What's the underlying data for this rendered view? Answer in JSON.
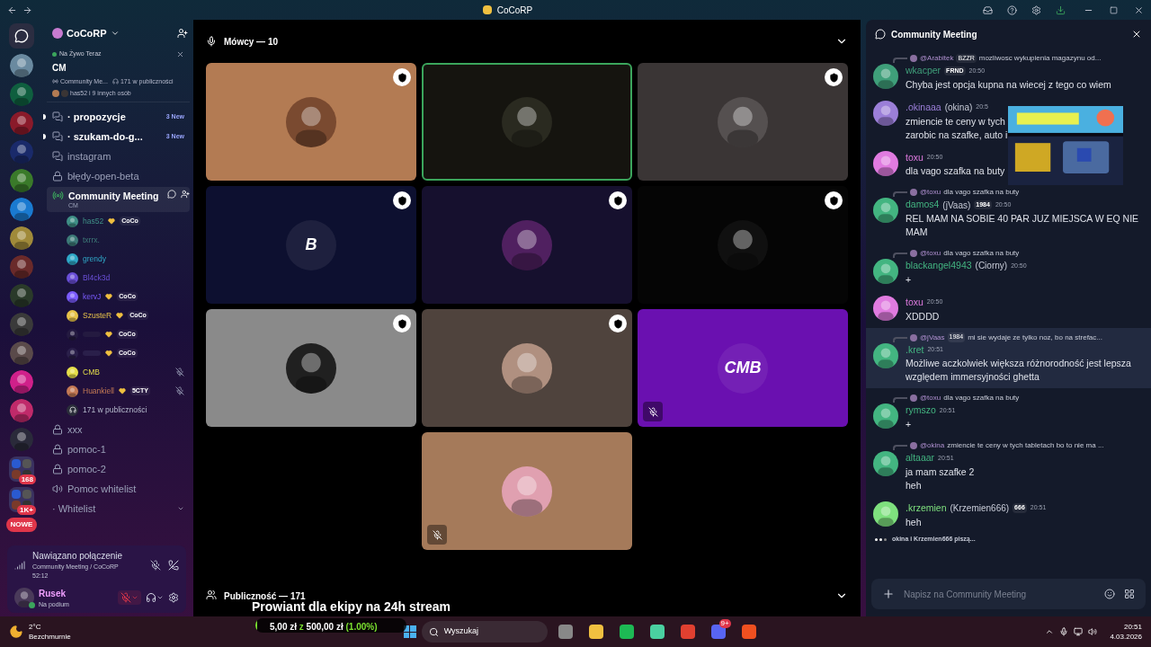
{
  "titlebar": {
    "title": "CoCoRP"
  },
  "servers": [
    {
      "kind": "home"
    },
    {
      "kind": "app"
    },
    {
      "kind": "app"
    },
    {
      "kind": "app"
    },
    {
      "kind": "app"
    },
    {
      "kind": "app"
    },
    {
      "kind": "app"
    },
    {
      "kind": "app"
    },
    {
      "kind": "app"
    },
    {
      "kind": "app"
    },
    {
      "kind": "app"
    },
    {
      "kind": "app"
    },
    {
      "kind": "app"
    },
    {
      "kind": "app"
    },
    {
      "kind": "app"
    },
    {
      "kind": "folder",
      "badge": "168"
    },
    {
      "kind": "folder",
      "badge": "1K+"
    },
    {
      "kind": "pill",
      "label": "NOWE"
    }
  ],
  "sidebar": {
    "server_name": "CoCoRP",
    "live": {
      "label": "Na Żywo Teraz",
      "title": "CM",
      "channel": "Community Me...",
      "audience": "171 w publiczności",
      "participants": "has52 i 9 innych osób"
    },
    "channels": [
      {
        "kind": "forum",
        "name": "· propozycje",
        "badge": "3 New",
        "unread": true,
        "selected": false
      },
      {
        "kind": "forum",
        "name": "· szukam-do-g...",
        "badge": "3 New",
        "unread": true,
        "selected": false
      },
      {
        "kind": "forum",
        "name": "instagram",
        "unread": false,
        "selected": false
      },
      {
        "kind": "locked",
        "name": "błędy-open-beta",
        "unread": false,
        "selected": false
      },
      {
        "kind": "stage",
        "name": "Community Meeting",
        "subtitle": "CM",
        "unread": true,
        "selected": true,
        "audience": "171 w publiczności",
        "members": [
          {
            "name": "has52",
            "color": "#3f8f86",
            "tag": "CoCo",
            "muted": false
          },
          {
            "name": "txrrx.",
            "color": "#3d7a78",
            "muted": false
          },
          {
            "name": "grendy",
            "color": "#2fa8c8",
            "muted": false
          },
          {
            "name": "Bl4ck3d",
            "color": "#6a4fd8",
            "muted": false
          },
          {
            "name": "kervJ",
            "color": "#7b5cff",
            "tag": "CoCo",
            "muted": false
          },
          {
            "name": "SzusteR",
            "color": "#e8c34a",
            "tag": "CoCo",
            "muted": false
          },
          {
            "tag": "CoCo",
            "color": "#241a40",
            "muted": false
          },
          {
            "tag": "CoCo",
            "color": "#2a1f4a",
            "muted": false
          },
          {
            "name": "CMB",
            "color": "#e6df4a",
            "muted": true
          },
          {
            "name": "Huankiell",
            "color": "#c47a55",
            "tag": "5CTY",
            "muted": true
          }
        ]
      },
      {
        "kind": "locked",
        "name": "xxx",
        "unread": false,
        "selected": false
      },
      {
        "kind": "locked",
        "name": "pomoc-1",
        "unread": false,
        "selected": false
      },
      {
        "kind": "locked",
        "name": "pomoc-2",
        "unread": false,
        "selected": false
      },
      {
        "kind": "voice",
        "name": "Pomoc whitelist",
        "unread": false,
        "selected": false
      },
      {
        "kind": "category",
        "name": "· Whitelist",
        "unread": false,
        "selected": false
      }
    ],
    "connection": {
      "status": "Nawiązano połączenie",
      "channel": "Community Meeting / CoCoRP",
      "timer": "52:12"
    },
    "user": {
      "name": "Rusek",
      "status": "Na podium",
      "mic_muted": true
    }
  },
  "stage": {
    "speakers": "Mówcy — 10",
    "audience": "Publiczność — 171",
    "tiles": [
      {
        "color": "#b37b53",
        "speaking": false,
        "moderator": true,
        "muted": false
      },
      {
        "color": "#15140f",
        "speaking": true,
        "moderator": false,
        "muted": false
      },
      {
        "color": "#3a3535",
        "speaking": false,
        "moderator": true,
        "muted": false
      },
      {
        "color": "#0d1030",
        "speaking": false,
        "moderator": true,
        "muted": false,
        "logo": "B"
      },
      {
        "color": "#16102e",
        "speaking": false,
        "moderator": true,
        "muted": false
      },
      {
        "color": "#050505",
        "speaking": false,
        "moderator": true,
        "muted": false
      },
      {
        "color": "#8a8a8a",
        "speaking": false,
        "moderator": true,
        "muted": false
      },
      {
        "color": "#4f433d",
        "speaking": false,
        "moderator": true,
        "muted": false
      },
      {
        "color": "#6a10b0",
        "speaking": false,
        "moderator": false,
        "muted": true,
        "logo": "CMB"
      },
      {
        "color": "#a57a5a",
        "speaking": false,
        "moderator": false,
        "muted": true
      }
    ]
  },
  "overlay": {
    "caption": "Prowiant dla ekipy na 24h stream",
    "amount": "5,00 zł",
    "separator": "z",
    "goal": "500,00 zł",
    "percent": "(1.00%)",
    "level": 0.01
  },
  "chat": {
    "title": "Community Meeting",
    "messages": [
      {
        "reply": {
          "name": "@Arabitek",
          "tag": "BZZR",
          "text": "mozliwosc wykupienia magazynu od..."
        },
        "author": "wkacper",
        "color": "#3f9f7a",
        "tag": "FRND",
        "time": "20:50",
        "lines": [
          "Chyba jest opcja kupna na wiecej z tego co wiem"
        ],
        "highlighted": false
      },
      {
        "author": ".okinaaa",
        "nick": "(okina)",
        "color": "#9b7fd8",
        "time": "20:5",
        "lines": [
          "zmiencie te ceny w tych",
          "zarobic na szafke, auto i"
        ],
        "highlighted": false
      },
      {
        "author": "toxu",
        "color": "#e07be0",
        "time": "20:50",
        "lines": [
          "dla vago szafka na buty"
        ],
        "highlighted": false
      },
      {
        "reply": {
          "name": "@toxu",
          "text": "dla vago szafka na buty"
        },
        "author": "damos4",
        "nick": "(jVaas)",
        "color": "#43b581",
        "tag": "1984",
        "time": "20:50",
        "lines": [
          "REL MAM NA SOBIE 40 PAR JUZ MIEJSCA W EQ NIE MAM"
        ],
        "highlighted": false
      },
      {
        "reply": {
          "name": "@toxu",
          "text": "dla vago szafka na buty"
        },
        "author": "blackangel4943",
        "nick": "(Ciorny)",
        "color": "#43b581",
        "time": "20:50",
        "lines": [
          "+"
        ],
        "highlighted": false
      },
      {
        "author": "toxu",
        "color": "#e07be0",
        "time": "20:50",
        "lines": [
          "XDDDD"
        ],
        "highlighted": false
      },
      {
        "reply": {
          "name": "@jVaas",
          "tag": "1984",
          "text": "mi sie wydaje ze tylko noz, bo na strefac..."
        },
        "author": ".kret",
        "color": "#43b581",
        "time": "20:51",
        "lines": [
          "Możliwe aczkolwiek większa różnorodność jest lepsza względem immersyjności ghetta"
        ],
        "highlighted": true
      },
      {
        "reply": {
          "name": "@toxu",
          "text": "dla vago szafka na buty"
        },
        "author": "rymszo",
        "color": "#43b581",
        "time": "20:51",
        "lines": [
          "+"
        ],
        "highlighted": false
      },
      {
        "reply": {
          "name": "@okina",
          "text": "zmiencie te ceny w tych tabletach bo to nie ma ..."
        },
        "author": "altaaar",
        "color": "#43b581",
        "time": "20:51",
        "lines": [
          "ja mam szafke 2",
          "heh"
        ],
        "highlighted": false
      },
      {
        "author": ".krzemien",
        "nick": "(Krzemien666)",
        "color": "#7ee07e",
        "tag": "666",
        "time": "20:51",
        "lines": [
          "heh"
        ],
        "highlighted": false
      }
    ],
    "typing": "okina i Krzemien666 piszą...",
    "placeholder": "Napisz na Community Meeting"
  },
  "taskbar": {
    "temperature": "2°C",
    "weather": "Bezchmurnie",
    "search": "Wyszukaj",
    "badge": "9+",
    "time": "20:51",
    "date": "4.03.2026"
  }
}
